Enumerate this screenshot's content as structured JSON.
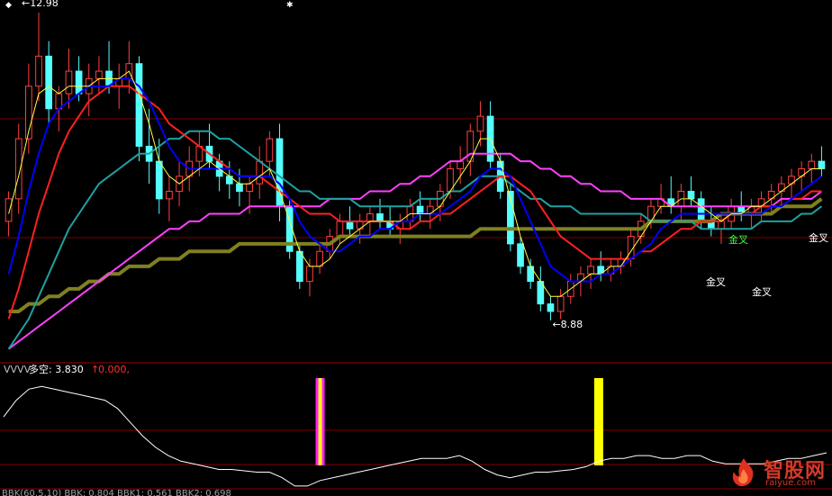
{
  "chart_data": [
    {
      "type": "candlestick",
      "annotations": {
        "high_label": "←12.98",
        "low_label": "←8.88",
        "golden_cross": "金叉"
      },
      "high_value": 12.98,
      "low_value": 8.88,
      "ylim": [
        8.4,
        13.1
      ],
      "colors": {
        "up": "#ff4040",
        "down": "#54ffff",
        "ma_short": "#ffff40",
        "ma_blue": "#0000ff",
        "ma_red": "#ff2020",
        "ma_teal": "#20a0a0",
        "ma_magenta": "#ff40ff",
        "ma_long": "#808020"
      },
      "candles": [
        [
          10.2,
          10.6,
          10.0,
          10.5
        ],
        [
          10.5,
          11.5,
          10.3,
          11.3
        ],
        [
          11.3,
          12.3,
          11.1,
          12.0
        ],
        [
          12.0,
          12.98,
          11.8,
          12.4
        ],
        [
          12.4,
          12.6,
          11.5,
          11.7
        ],
        [
          11.7,
          12.0,
          11.4,
          11.9
        ],
        [
          11.9,
          12.5,
          11.7,
          12.2
        ],
        [
          12.2,
          12.4,
          11.8,
          11.9
        ],
        [
          11.9,
          12.3,
          11.6,
          12.1
        ],
        [
          12.1,
          12.4,
          11.9,
          12.2
        ],
        [
          12.2,
          12.6,
          11.9,
          12.0
        ],
        [
          12.0,
          12.3,
          11.7,
          12.1
        ],
        [
          12.1,
          12.6,
          11.9,
          12.3
        ],
        [
          12.3,
          12.4,
          11.0,
          11.2
        ],
        [
          11.2,
          11.7,
          10.7,
          11.0
        ],
        [
          11.0,
          11.3,
          10.3,
          10.5
        ],
        [
          10.5,
          10.8,
          10.2,
          10.6
        ],
        [
          10.6,
          11.0,
          10.4,
          10.8
        ],
        [
          10.8,
          11.2,
          10.6,
          11.0
        ],
        [
          11.0,
          11.4,
          10.8,
          11.2
        ],
        [
          11.2,
          11.5,
          10.9,
          11.0
        ],
        [
          11.0,
          11.1,
          10.6,
          10.8
        ],
        [
          10.8,
          11.0,
          10.5,
          10.7
        ],
        [
          10.7,
          10.9,
          10.4,
          10.6
        ],
        [
          10.6,
          10.8,
          10.3,
          10.7
        ],
        [
          10.7,
          11.2,
          10.5,
          11.0
        ],
        [
          11.0,
          11.4,
          10.8,
          11.3
        ],
        [
          11.3,
          11.5,
          10.2,
          10.4
        ],
        [
          10.4,
          10.5,
          9.7,
          9.8
        ],
        [
          9.8,
          9.9,
          9.3,
          9.4
        ],
        [
          9.4,
          9.7,
          9.2,
          9.6
        ],
        [
          9.6,
          9.9,
          9.5,
          9.8
        ],
        [
          9.8,
          10.1,
          9.7,
          10.0
        ],
        [
          10.0,
          10.3,
          9.9,
          10.2
        ],
        [
          10.2,
          10.4,
          10.0,
          10.1
        ],
        [
          10.1,
          10.3,
          9.9,
          10.2
        ],
        [
          10.2,
          10.4,
          10.0,
          10.3
        ],
        [
          10.3,
          10.5,
          10.1,
          10.2
        ],
        [
          10.2,
          10.4,
          10.0,
          10.1
        ],
        [
          10.1,
          10.3,
          9.9,
          10.2
        ],
        [
          10.2,
          10.5,
          10.1,
          10.4
        ],
        [
          10.4,
          10.6,
          10.2,
          10.3
        ],
        [
          10.3,
          10.5,
          10.1,
          10.4
        ],
        [
          10.4,
          10.7,
          10.2,
          10.6
        ],
        [
          10.6,
          11.0,
          10.5,
          10.9
        ],
        [
          10.9,
          11.2,
          10.7,
          11.0
        ],
        [
          11.0,
          11.5,
          10.8,
          11.4
        ],
        [
          11.4,
          11.8,
          11.2,
          11.6
        ],
        [
          11.6,
          11.8,
          10.9,
          11.0
        ],
        [
          11.0,
          11.1,
          10.5,
          10.6
        ],
        [
          10.6,
          10.7,
          9.8,
          9.9
        ],
        [
          9.9,
          10.0,
          9.5,
          9.6
        ],
        [
          9.6,
          9.7,
          9.3,
          9.4
        ],
        [
          9.4,
          9.6,
          9.0,
          9.1
        ],
        [
          9.1,
          9.2,
          8.88,
          9.0
        ],
        [
          9.0,
          9.3,
          8.9,
          9.2
        ],
        [
          9.2,
          9.5,
          9.1,
          9.4
        ],
        [
          9.4,
          9.6,
          9.2,
          9.5
        ],
        [
          9.5,
          9.7,
          9.3,
          9.6
        ],
        [
          9.6,
          9.8,
          9.4,
          9.5
        ],
        [
          9.5,
          9.7,
          9.4,
          9.6
        ],
        [
          9.6,
          9.8,
          9.5,
          9.7
        ],
        [
          9.7,
          10.1,
          9.6,
          10.0
        ],
        [
          10.0,
          10.3,
          9.9,
          10.2
        ],
        [
          10.2,
          10.5,
          10.1,
          10.4
        ],
        [
          10.4,
          10.7,
          10.3,
          10.5
        ],
        [
          10.5,
          10.8,
          10.3,
          10.4
        ],
        [
          10.4,
          10.7,
          10.2,
          10.6
        ],
        [
          10.6,
          10.8,
          10.4,
          10.5
        ],
        [
          10.5,
          10.6,
          10.1,
          10.2
        ],
        [
          10.2,
          10.4,
          10.0,
          10.1
        ],
        [
          10.1,
          10.3,
          9.9,
          10.2
        ],
        [
          10.2,
          10.5,
          10.1,
          10.4
        ],
        [
          10.4,
          10.6,
          10.2,
          10.3
        ],
        [
          10.3,
          10.5,
          10.1,
          10.4
        ],
        [
          10.4,
          10.6,
          10.2,
          10.5
        ],
        [
          10.5,
          10.7,
          10.3,
          10.6
        ],
        [
          10.6,
          10.8,
          10.4,
          10.7
        ],
        [
          10.7,
          10.9,
          10.5,
          10.8
        ],
        [
          10.8,
          11.0,
          10.6,
          10.9
        ],
        [
          10.9,
          11.1,
          10.7,
          11.0
        ],
        [
          11.0,
          11.2,
          10.8,
          10.9
        ]
      ],
      "ma": {
        "short": [
          10.3,
          10.8,
          11.4,
          11.9,
          12.0,
          11.9,
          12.0,
          12.0,
          12.0,
          12.1,
          12.1,
          12.1,
          12.2,
          11.9,
          11.5,
          11.0,
          10.8,
          10.7,
          10.8,
          10.9,
          11.0,
          10.9,
          10.8,
          10.7,
          10.7,
          10.8,
          10.9,
          10.6,
          10.2,
          9.8,
          9.6,
          9.6,
          9.7,
          9.9,
          10.0,
          10.1,
          10.2,
          10.2,
          10.2,
          10.2,
          10.3,
          10.3,
          10.3,
          10.4,
          10.6,
          10.8,
          11.0,
          11.3,
          11.3,
          11.0,
          10.5,
          10.0,
          9.6,
          9.4,
          9.2,
          9.2,
          9.3,
          9.4,
          9.5,
          9.5,
          9.6,
          9.6,
          9.8,
          10.0,
          10.2,
          10.4,
          10.4,
          10.5,
          10.5,
          10.4,
          10.3,
          10.2,
          10.3,
          10.3,
          10.4,
          10.4,
          10.5,
          10.6,
          10.7,
          10.8,
          10.9,
          10.9
        ],
        "blue": [
          9.5,
          10.0,
          10.6,
          11.1,
          11.5,
          11.7,
          11.8,
          11.9,
          12.0,
          12.0,
          12.0,
          12.1,
          12.1,
          12.0,
          11.8,
          11.5,
          11.2,
          11.0,
          10.9,
          10.9,
          10.9,
          10.9,
          10.9,
          10.8,
          10.8,
          10.8,
          10.8,
          10.7,
          10.5,
          10.2,
          10.0,
          9.9,
          9.8,
          9.8,
          9.9,
          10.0,
          10.0,
          10.1,
          10.1,
          10.2,
          10.2,
          10.3,
          10.3,
          10.3,
          10.4,
          10.5,
          10.6,
          10.8,
          10.9,
          10.9,
          10.8,
          10.5,
          10.2,
          9.9,
          9.6,
          9.5,
          9.4,
          9.4,
          9.4,
          9.5,
          9.5,
          9.6,
          9.7,
          9.8,
          9.9,
          10.1,
          10.2,
          10.3,
          10.3,
          10.3,
          10.3,
          10.3,
          10.3,
          10.3,
          10.3,
          10.3,
          10.4,
          10.4,
          10.5,
          10.6,
          10.7,
          10.8
        ],
        "red": [
          8.9,
          9.3,
          9.8,
          10.3,
          10.7,
          11.1,
          11.4,
          11.6,
          11.8,
          11.9,
          12.0,
          12.0,
          12.0,
          11.9,
          11.8,
          11.7,
          11.5,
          11.4,
          11.3,
          11.2,
          11.1,
          11.0,
          10.9,
          10.8,
          10.8,
          10.8,
          10.7,
          10.6,
          10.5,
          10.4,
          10.3,
          10.3,
          10.3,
          10.2,
          10.2,
          10.2,
          10.2,
          10.2,
          10.2,
          10.1,
          10.1,
          10.2,
          10.2,
          10.3,
          10.3,
          10.4,
          10.5,
          10.6,
          10.7,
          10.8,
          10.8,
          10.7,
          10.6,
          10.4,
          10.2,
          10.0,
          9.9,
          9.8,
          9.7,
          9.7,
          9.7,
          9.7,
          9.7,
          9.8,
          9.8,
          9.9,
          10.0,
          10.1,
          10.1,
          10.2,
          10.2,
          10.2,
          10.3,
          10.3,
          10.3,
          10.4,
          10.4,
          10.4,
          10.5,
          10.5,
          10.6,
          10.6
        ],
        "teal": [
          8.5,
          8.7,
          8.9,
          9.2,
          9.5,
          9.8,
          10.1,
          10.3,
          10.5,
          10.7,
          10.8,
          10.9,
          11.0,
          11.1,
          11.1,
          11.2,
          11.3,
          11.3,
          11.4,
          11.4,
          11.4,
          11.3,
          11.3,
          11.2,
          11.1,
          11.0,
          10.9,
          10.8,
          10.7,
          10.6,
          10.6,
          10.5,
          10.5,
          10.5,
          10.5,
          10.4,
          10.4,
          10.4,
          10.4,
          10.4,
          10.4,
          10.5,
          10.5,
          10.5,
          10.6,
          10.6,
          10.7,
          10.8,
          10.8,
          10.8,
          10.7,
          10.6,
          10.5,
          10.5,
          10.4,
          10.4,
          10.4,
          10.3,
          10.3,
          10.3,
          10.3,
          10.3,
          10.3,
          10.3,
          10.2,
          10.2,
          10.2,
          10.2,
          10.2,
          10.1,
          10.1,
          10.1,
          10.1,
          10.1,
          10.1,
          10.2,
          10.2,
          10.2,
          10.2,
          10.3,
          10.3,
          10.4
        ],
        "magenta": [
          8.5,
          8.6,
          8.7,
          8.8,
          8.9,
          9.0,
          9.1,
          9.2,
          9.3,
          9.4,
          9.5,
          9.6,
          9.7,
          9.8,
          9.9,
          10.0,
          10.1,
          10.1,
          10.2,
          10.2,
          10.3,
          10.3,
          10.3,
          10.3,
          10.4,
          10.4,
          10.4,
          10.4,
          10.4,
          10.4,
          10.4,
          10.4,
          10.5,
          10.5,
          10.5,
          10.5,
          10.6,
          10.6,
          10.6,
          10.7,
          10.7,
          10.8,
          10.8,
          10.9,
          11.0,
          11.0,
          11.1,
          11.1,
          11.1,
          11.1,
          11.1,
          11.0,
          11.0,
          10.9,
          10.9,
          10.8,
          10.8,
          10.7,
          10.7,
          10.6,
          10.6,
          10.6,
          10.5,
          10.5,
          10.5,
          10.5,
          10.4,
          10.4,
          10.4,
          10.4,
          10.4,
          10.4,
          10.4,
          10.4,
          10.4,
          10.4,
          10.4,
          10.5,
          10.5,
          10.5,
          10.5,
          10.6
        ],
        "long": [
          9.0,
          9.0,
          9.1,
          9.1,
          9.2,
          9.2,
          9.3,
          9.3,
          9.4,
          9.4,
          9.5,
          9.5,
          9.6,
          9.6,
          9.6,
          9.7,
          9.7,
          9.7,
          9.8,
          9.8,
          9.8,
          9.8,
          9.8,
          9.9,
          9.9,
          9.9,
          9.9,
          9.9,
          9.9,
          9.9,
          9.9,
          9.9,
          9.9,
          10.0,
          10.0,
          10.0,
          10.0,
          10.0,
          10.0,
          10.0,
          10.0,
          10.0,
          10.0,
          10.0,
          10.0,
          10.0,
          10.0,
          10.1,
          10.1,
          10.1,
          10.1,
          10.1,
          10.1,
          10.1,
          10.1,
          10.1,
          10.1,
          10.1,
          10.1,
          10.1,
          10.1,
          10.1,
          10.1,
          10.1,
          10.2,
          10.2,
          10.2,
          10.2,
          10.2,
          10.2,
          10.2,
          10.3,
          10.3,
          10.3,
          10.3,
          10.3,
          10.3,
          10.4,
          10.4,
          10.4,
          10.4,
          10.5
        ]
      }
    },
    {
      "type": "line",
      "header": {
        "name": "VVVV",
        "label": "多空: 3.830",
        "arrow": "↑",
        "value2": "0.000,"
      },
      "label_colors": {
        "name": "#c0c0c0",
        "label": "#ffffff",
        "arrow": "#ff3030",
        "value2": "#ff3030"
      },
      "ylim": [
        -0.6,
        3.4
      ],
      "series_color": "#ffffff",
      "values": [
        2.0,
        2.6,
        3.0,
        3.1,
        3.0,
        2.9,
        2.8,
        2.7,
        2.6,
        2.3,
        1.8,
        1.3,
        0.9,
        0.6,
        0.4,
        0.3,
        0.2,
        0.1,
        0.1,
        0.05,
        0.0,
        0.0,
        -0.2,
        -0.5,
        -0.5,
        -0.3,
        -0.2,
        -0.1,
        0.0,
        0.1,
        0.2,
        0.3,
        0.4,
        0.5,
        0.5,
        0.5,
        0.6,
        0.4,
        0.1,
        -0.1,
        -0.2,
        -0.1,
        0.0,
        0.0,
        0.05,
        0.1,
        0.2,
        0.4,
        0.5,
        0.5,
        0.6,
        0.6,
        0.5,
        0.5,
        0.6,
        0.6,
        0.4,
        0.3,
        0.3,
        0.3,
        0.3,
        0.4,
        0.5,
        0.5,
        0.6,
        0.7
      ],
      "bars": [
        {
          "index": 25,
          "color": "#ff20ff",
          "inner": "#ffff00"
        },
        {
          "index": 47,
          "color": "#ffff00",
          "inner": "#ffff00"
        }
      ],
      "footer": "BBK(60,5,10) BBK: 0.804  BBK1: 0.561  BBK2: 0.698"
    }
  ],
  "watermark": {
    "title": "智股网",
    "url": "raiyue.com"
  }
}
